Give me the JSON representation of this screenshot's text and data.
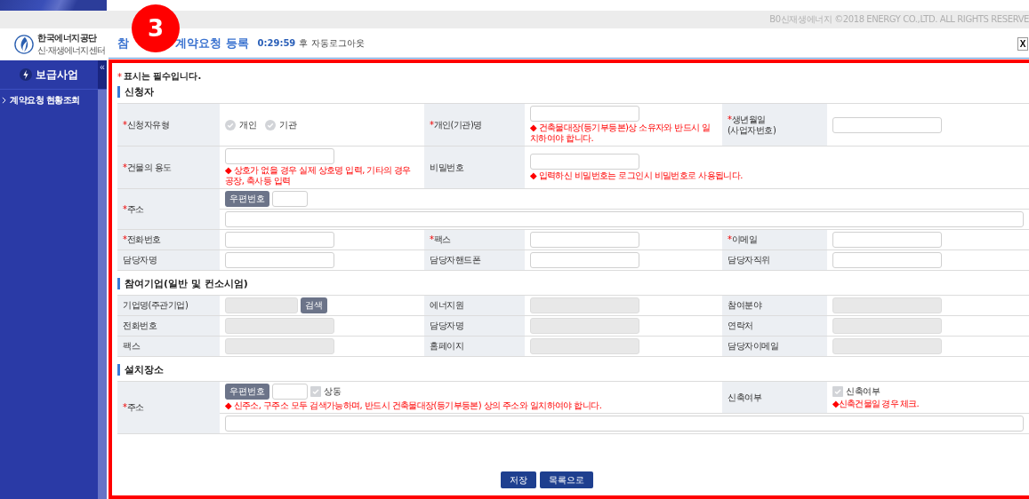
{
  "top_bar": {
    "copyright": "B0신재생에너지 ©2018 ENERGY CO.,LTD. ALL RIGHTS RESERVE"
  },
  "logo": {
    "name": "한국에너지공단",
    "subtitle": "신·재생에너지센터"
  },
  "sidebar": {
    "title": "보급사업",
    "collapse": "«",
    "items": [
      {
        "label": "계약요청 현황조회"
      }
    ]
  },
  "header": {
    "title_start": "참",
    "title_end": "계약요청 등록",
    "timer": "0:29:59",
    "timer_suffix": "후 자동로그아웃",
    "close": "X"
  },
  "step_badge": "3",
  "required_note": {
    "mark": "*",
    "text": "표시는 필수입니다."
  },
  "sections": [
    {
      "title": "신청자",
      "rows": [
        {
          "kind": "fields",
          "cells": [
            {
              "kind": "label",
              "text": "신청자유형",
              "required": true
            },
            {
              "kind": "radios",
              "options": [
                {
                  "label": "개인",
                  "selected": false
                },
                {
                  "label": "기관",
                  "selected": false
                }
              ]
            },
            {
              "kind": "label",
              "text": "개인(기관)명",
              "required": true
            },
            {
              "kind": "input",
              "disabled": false,
              "note": "◆ 건축물대장(등기부등본)상 소유자와 반드시 일치하여야 합니다."
            },
            {
              "kind": "label",
              "text": "생년월일",
              "sub": "(사업자번호)",
              "required": true
            },
            {
              "kind": "input",
              "disabled": false
            }
          ]
        },
        {
          "kind": "fields",
          "cells": [
            {
              "kind": "label",
              "text": "건물의 용도",
              "required": true
            },
            {
              "kind": "input",
              "disabled": false,
              "note": "◆ 상호가 없을 경우 실제 상호명 입력, 기타의 경우 공장, 축사등 입력"
            },
            {
              "kind": "label",
              "text": "비밀번호",
              "required": false
            },
            {
              "kind": "input",
              "disabled": false,
              "note": "◆ 입력하신 비밀번호는 로그인시 비밀번호로 사용됩니다."
            }
          ]
        },
        {
          "kind": "address",
          "label": {
            "text": "주소",
            "required": true
          },
          "zip_button": "우편번호",
          "extra": []
        },
        {
          "kind": "fields",
          "cells": [
            {
              "kind": "label",
              "text": "전화번호",
              "required": true
            },
            {
              "kind": "input",
              "disabled": false
            },
            {
              "kind": "label",
              "text": "팩스",
              "required": true
            },
            {
              "kind": "input",
              "disabled": false
            },
            {
              "kind": "label",
              "text": "이메일",
              "required": true
            },
            {
              "kind": "input",
              "disabled": false
            }
          ]
        },
        {
          "kind": "fields",
          "cells": [
            {
              "kind": "label",
              "text": "담당자명",
              "required": false
            },
            {
              "kind": "input",
              "disabled": false
            },
            {
              "kind": "label",
              "text": "담당자핸드폰",
              "required": false
            },
            {
              "kind": "input",
              "disabled": false
            },
            {
              "kind": "label",
              "text": "담당자직위",
              "required": false
            },
            {
              "kind": "input",
              "disabled": false
            }
          ]
        }
      ]
    },
    {
      "title": "참여기업(일반 및 컨소시엄)",
      "rows": [
        {
          "kind": "fields",
          "cells": [
            {
              "kind": "label",
              "text": "기업명(주관기업)",
              "required": false
            },
            {
              "kind": "input",
              "disabled": true,
              "button": "검색"
            },
            {
              "kind": "label",
              "text": "에너지원",
              "required": false
            },
            {
              "kind": "input",
              "disabled": true
            },
            {
              "kind": "label",
              "text": "참여분야",
              "required": false
            },
            {
              "kind": "input",
              "disabled": true
            }
          ]
        },
        {
          "kind": "fields",
          "cells": [
            {
              "kind": "label",
              "text": "전화번호",
              "required": false
            },
            {
              "kind": "input",
              "disabled": true
            },
            {
              "kind": "label",
              "text": "담당자명",
              "required": false
            },
            {
              "kind": "input",
              "disabled": true
            },
            {
              "kind": "label",
              "text": "연락처",
              "required": false
            },
            {
              "kind": "input",
              "disabled": true
            }
          ]
        },
        {
          "kind": "fields",
          "cells": [
            {
              "kind": "label",
              "text": "팩스",
              "required": false
            },
            {
              "kind": "input",
              "disabled": true
            },
            {
              "kind": "label",
              "text": "홈페이지",
              "required": false
            },
            {
              "kind": "input",
              "disabled": true
            },
            {
              "kind": "label",
              "text": "담당자이메일",
              "required": false
            },
            {
              "kind": "input",
              "disabled": true
            }
          ]
        }
      ]
    },
    {
      "title": "설치장소",
      "rows": [
        {
          "kind": "address",
          "label": {
            "text": "주소",
            "required": true
          },
          "zip_button": "우편번호",
          "same_checkbox": {
            "label": "상동",
            "checked": false
          },
          "note": "◆ 신주소, 구주소 모두 검색가능하며, 반드시 건축물대장(등기부등본) 상의 주소와 일치하여야 합니다.",
          "extra": [
            {
              "kind": "label",
              "text": "신축여부",
              "required": false
            },
            {
              "kind": "checkbox",
              "label": "신축여부",
              "checked": false,
              "note": "◆신축건물일 경우 체크."
            }
          ]
        }
      ]
    }
  ],
  "buttons": [
    {
      "label": "저장"
    },
    {
      "label": "목록으로"
    }
  ]
}
